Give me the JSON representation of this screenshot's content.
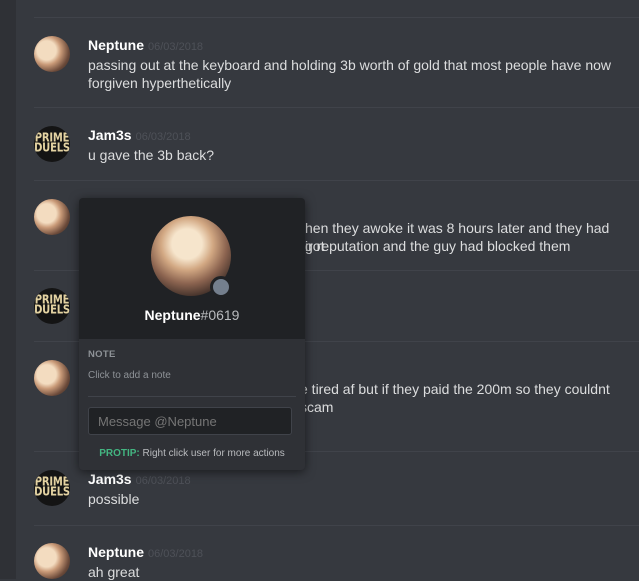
{
  "messages": [
    {
      "user": "Neptune",
      "time": "06/03/2018",
      "avatar": "neptune",
      "text": "passing out at the keyboard and holding 3b worth of gold that most people have now forgiven hyperthetically"
    },
    {
      "user": "Jam3s",
      "time": "06/03/2018",
      "avatar": "prime-duels",
      "text": "u gave the 3b back?"
    },
    {
      "user": "",
      "time": "",
      "avatar": "neptune",
      "text": "hen they awoke it was 8 hours later and they had got",
      "text2": "ir reputation and the guy had blocked them"
    },
    {
      "user": "",
      "time": "",
      "avatar": "prime-duels",
      "text": ""
    },
    {
      "user": "",
      "time": "",
      "avatar": "neptune",
      "text": "e tired af but if they paid the 200m so they couldnt scam"
    },
    {
      "user": "Jam3s",
      "time": "06/03/2018",
      "avatar": "prime-duels",
      "text": "possible"
    },
    {
      "user": "Neptune",
      "time": "06/03/2018",
      "avatar": "neptune",
      "text": "ah great"
    }
  ],
  "avatar_logo": {
    "line1": "PRIME",
    "line2": "DUELS"
  },
  "popout": {
    "username": "Neptune",
    "discriminator": "#0619",
    "status": "offline",
    "note_label": "NOTE",
    "note_placeholder": "Click to add a note",
    "message_placeholder": "Message @Neptune",
    "protip_label": "PROTIP:",
    "protip_text": " Right click user for more actions"
  },
  "colors": {
    "background": "#36393f",
    "popout": "#2f3136",
    "protip": "#43b581"
  }
}
